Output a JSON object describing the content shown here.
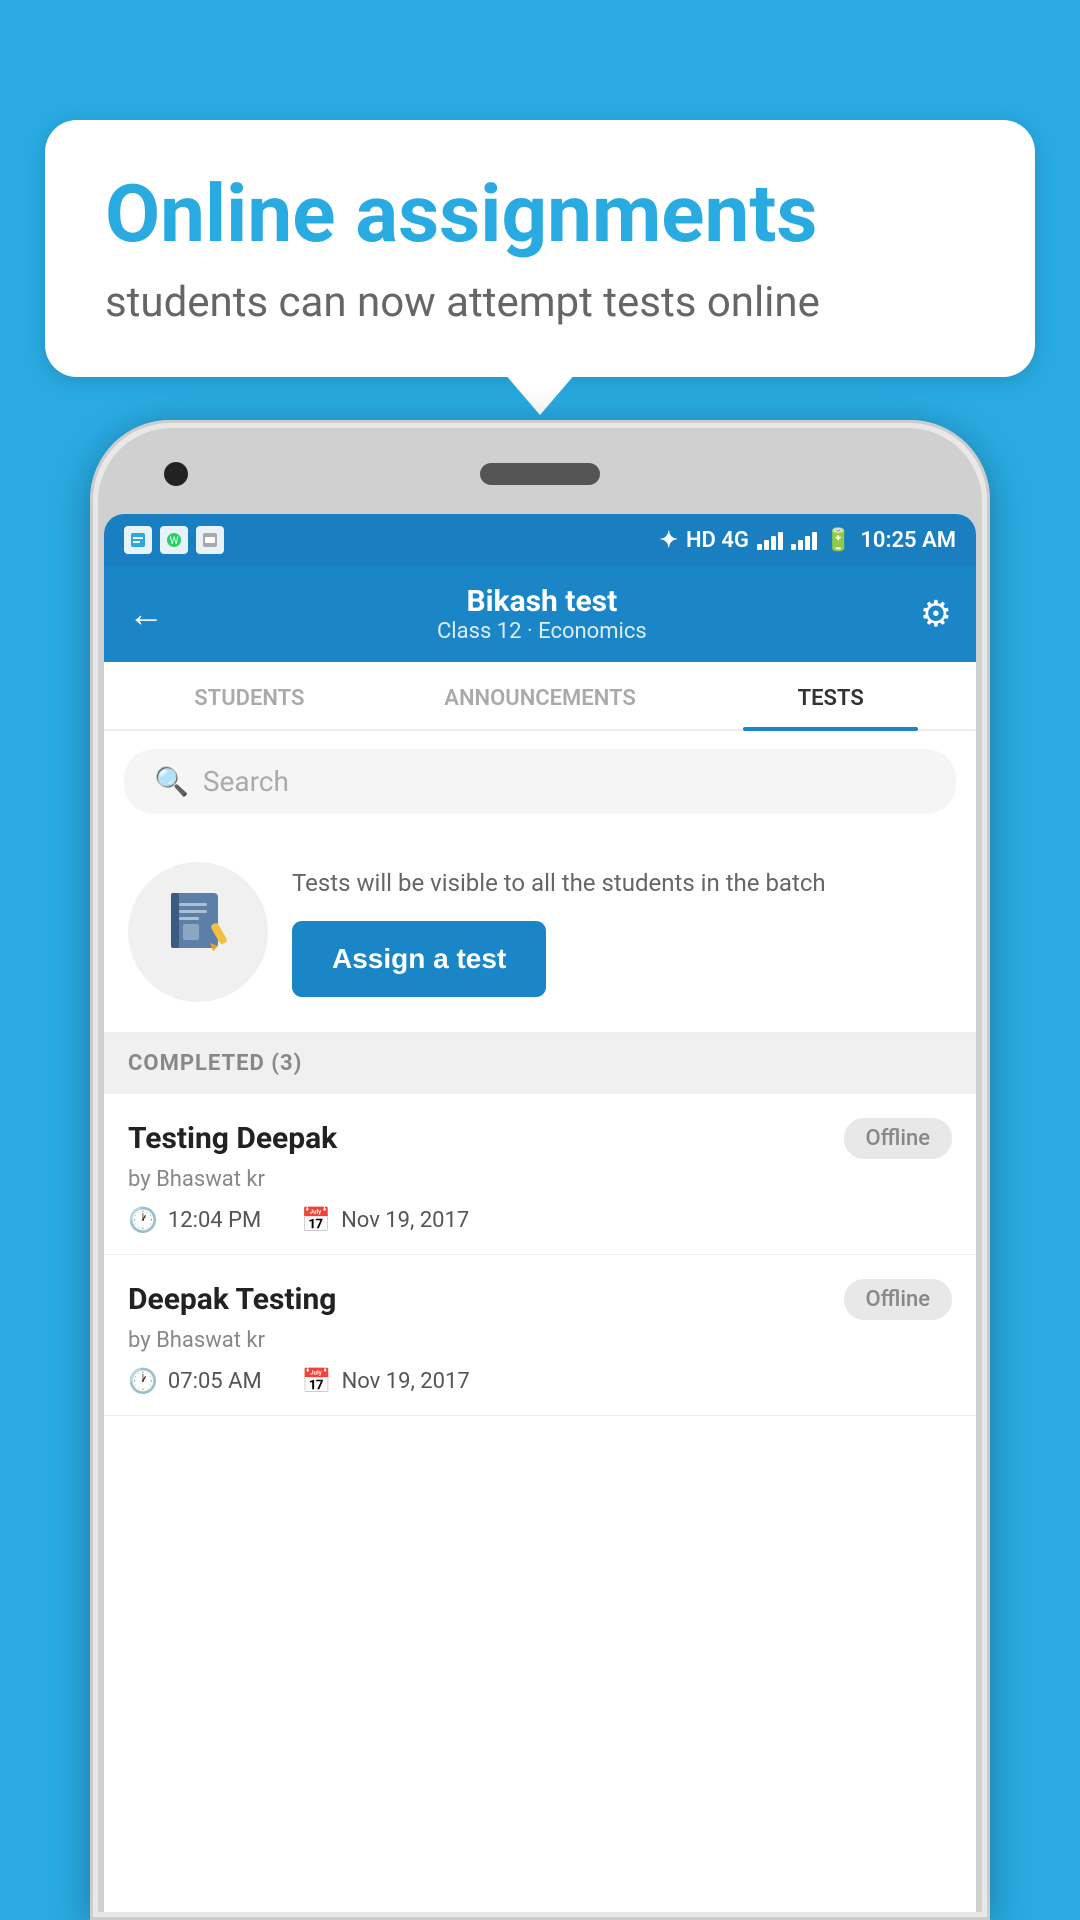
{
  "background_color": "#29ABE2",
  "bubble": {
    "title": "Online assignments",
    "subtitle": "students can now attempt tests online"
  },
  "status_bar": {
    "time": "10:25 AM",
    "network": "HD 4G",
    "bluetooth": "✦"
  },
  "header": {
    "title": "Bikash test",
    "subtitle": "Class 12 · Economics",
    "back_label": "←",
    "gear_label": "⚙"
  },
  "tabs": [
    {
      "label": "STUDENTS",
      "active": false
    },
    {
      "label": "ANNOUNCEMENTS",
      "active": false
    },
    {
      "label": "TESTS",
      "active": true
    }
  ],
  "search": {
    "placeholder": "Search"
  },
  "assign_section": {
    "icon": "📓",
    "info_text": "Tests will be visible to all the students in the batch",
    "button_label": "Assign a test"
  },
  "completed_section": {
    "header": "COMPLETED (3)",
    "items": [
      {
        "name": "Testing Deepak",
        "badge": "Offline",
        "by": "by Bhaswat kr",
        "time": "12:04 PM",
        "date": "Nov 19, 2017"
      },
      {
        "name": "Deepak Testing",
        "badge": "Offline",
        "by": "by Bhaswat kr",
        "time": "07:05 AM",
        "date": "Nov 19, 2017"
      }
    ]
  }
}
